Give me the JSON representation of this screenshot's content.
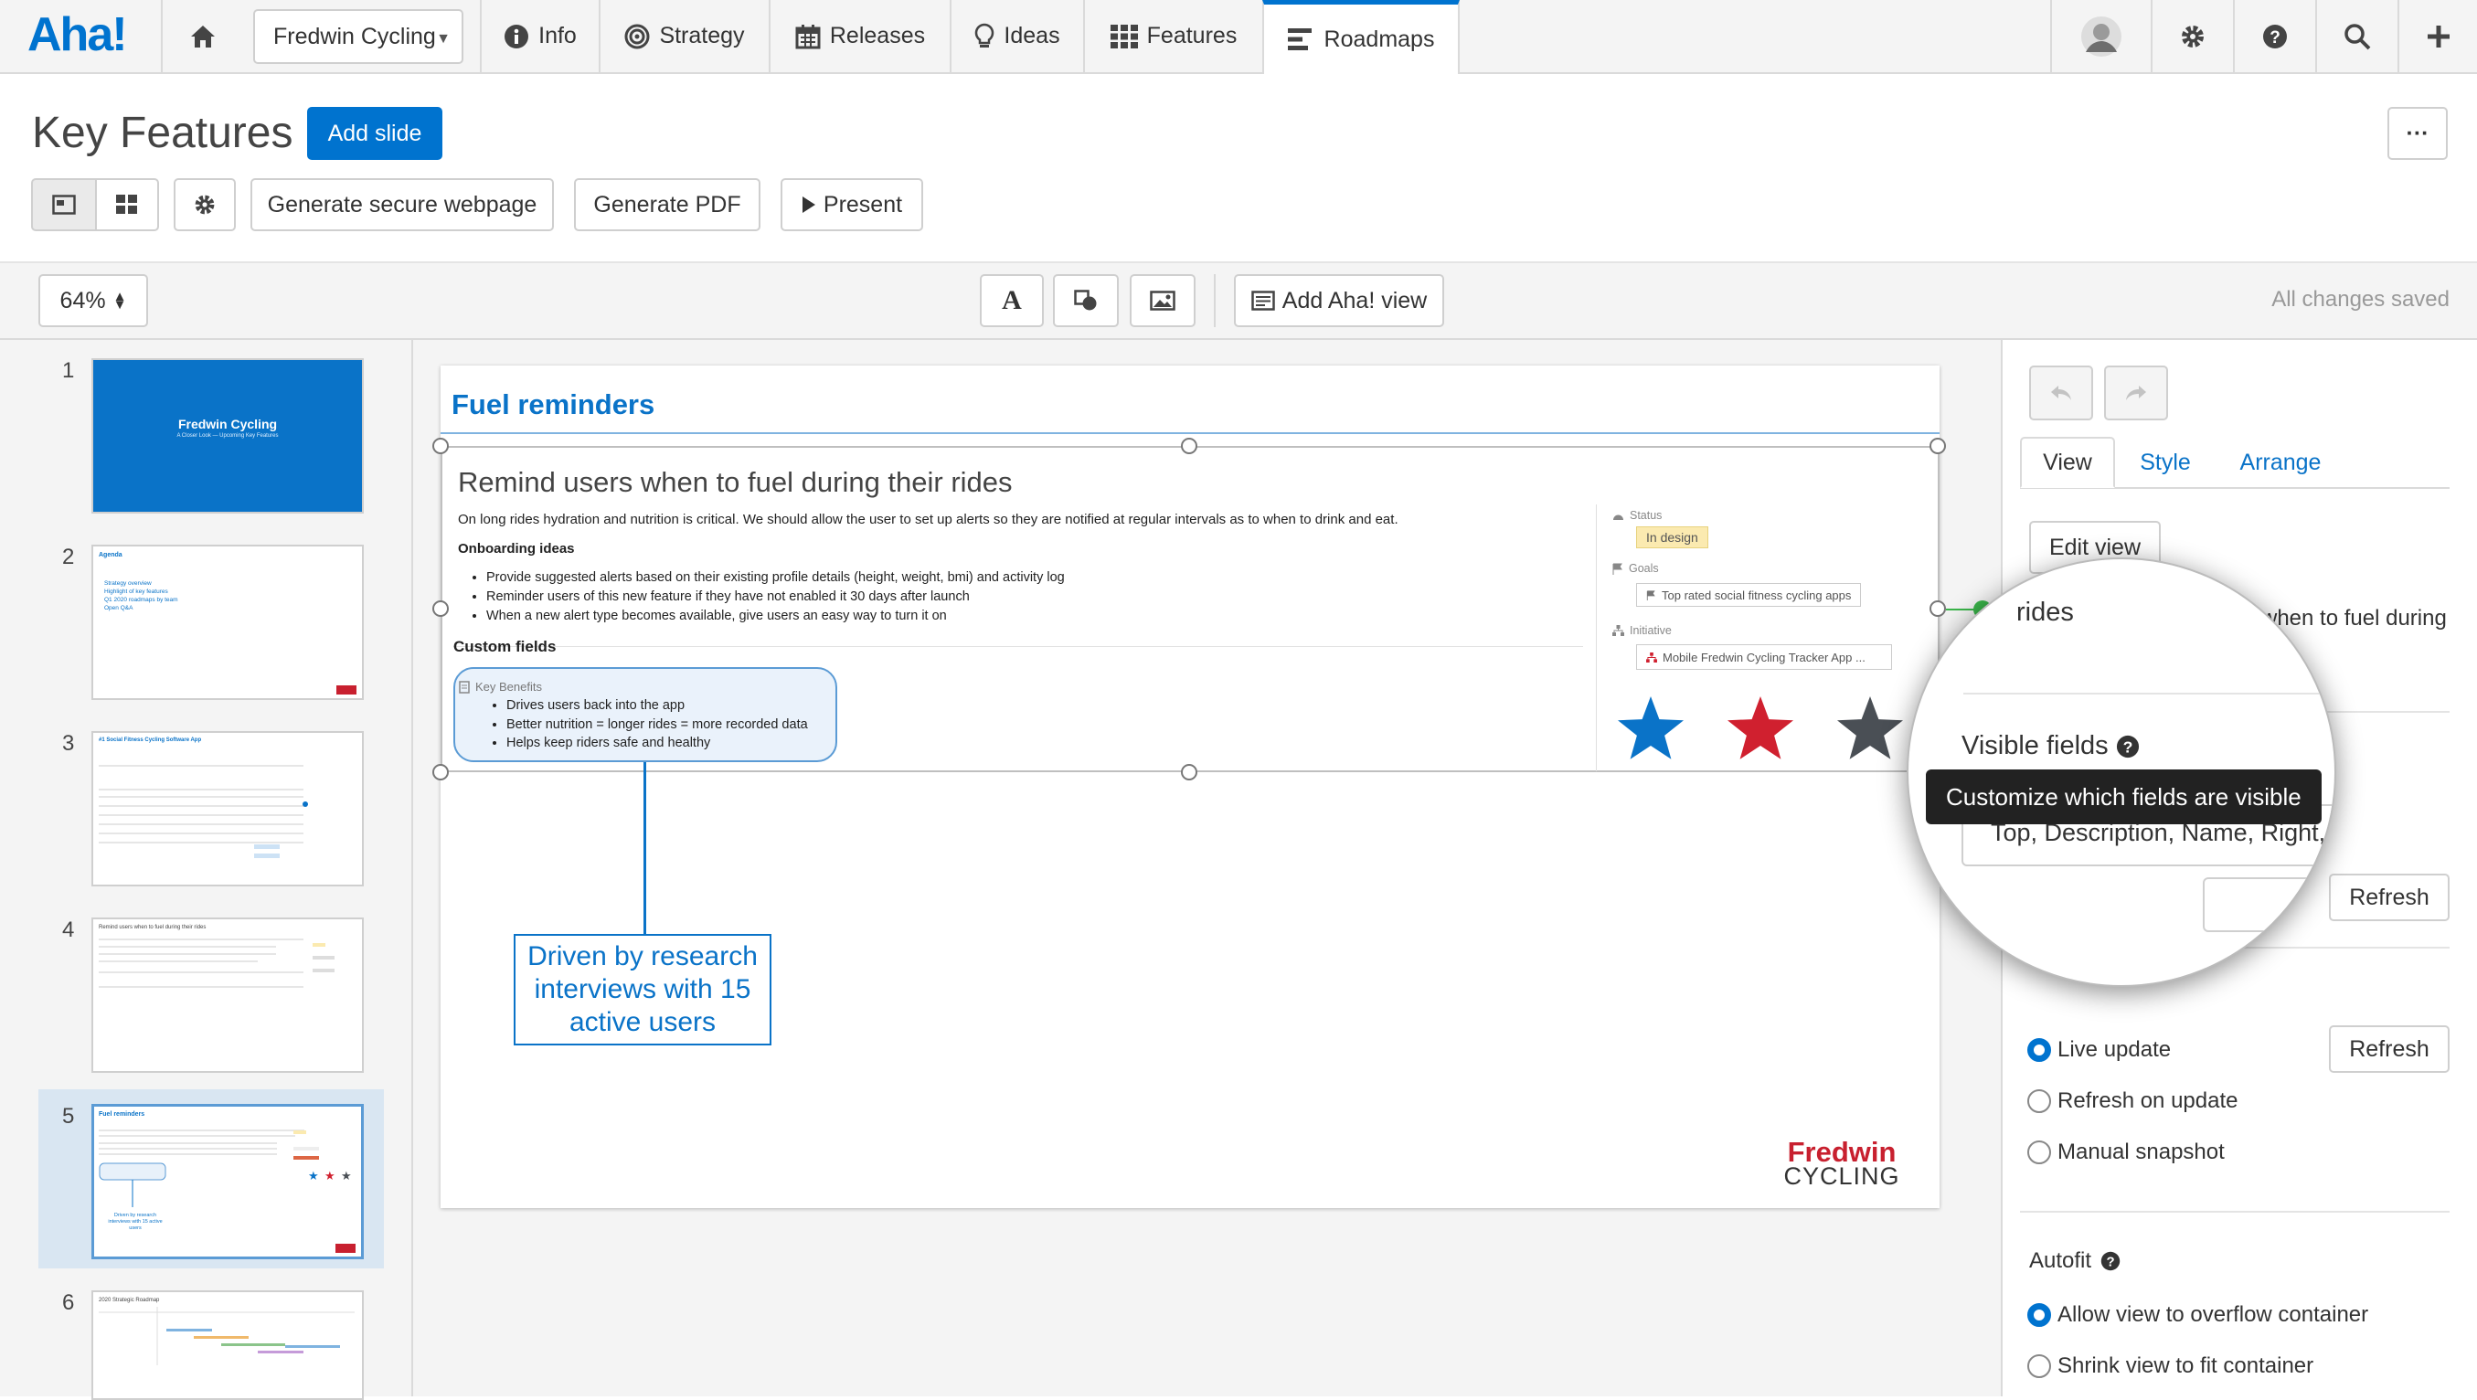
{
  "app": {
    "logo": "Aha!",
    "workspace": "Fredwin Cycling"
  },
  "nav": {
    "tabs": [
      {
        "label": "Info",
        "icon": "info-icon"
      },
      {
        "label": "Strategy",
        "icon": "target-icon"
      },
      {
        "label": "Releases",
        "icon": "calendar-icon"
      },
      {
        "label": "Ideas",
        "icon": "lightbulb-icon"
      },
      {
        "label": "Features",
        "icon": "grid-icon"
      },
      {
        "label": "Roadmaps",
        "icon": "roadmap-icon"
      }
    ],
    "active": "Roadmaps"
  },
  "header": {
    "title": "Key Features",
    "add_slide": "Add slide",
    "more": "···",
    "generate_webpage": "Generate secure webpage",
    "generate_pdf": "Generate PDF",
    "present": "Present"
  },
  "toolbar": {
    "zoom": "64%",
    "add_view": "Add Aha! view",
    "status": "All changes saved"
  },
  "thumbnails": [
    {
      "num": "1",
      "title": "Fredwin Cycling",
      "subtitle": "A Closer Look — Upcoming Key Features"
    },
    {
      "num": "2",
      "title": "Agenda",
      "items": [
        "Strategy overview",
        "Highlight of key features",
        "Q1 2020 roadmaps by team",
        "Open Q&A"
      ]
    },
    {
      "num": "3",
      "title": "#1 Social Fitness Cycling Software App"
    },
    {
      "num": "4",
      "title": "Remind users when to fuel during their rides"
    },
    {
      "num": "5",
      "title": "Fuel reminders",
      "callout": "Driven by research interviews with 15 active users"
    },
    {
      "num": "6",
      "title": "2020 Strategic Roadmap"
    }
  ],
  "slide": {
    "title": "Fuel reminders",
    "feature": {
      "name": "Remind users when to fuel during their rides",
      "description": "On long rides hydration and nutrition is critical. We should allow the user to set up alerts so they are notified at regular intervals as to when to drink and eat.",
      "onboarding_heading": "Onboarding ideas",
      "onboarding": [
        "Provide suggested alerts based on their existing profile details (height, weight, bmi) and activity log",
        "Reminder users of this new feature if they have not enabled it 30 days after launch",
        "When a new alert type becomes available, give users an easy way to turn it on"
      ],
      "custom_fields_heading": "Custom fields",
      "benefits_label": "Key Benefits",
      "benefits": [
        "Drives users back into the app",
        "Better nutrition = longer rides = more recorded data",
        "Helps keep riders safe and healthy"
      ],
      "status_label": "Status",
      "status_value": "In design",
      "goals_label": "Goals",
      "goals_value": "Top rated social fitness cycling apps",
      "initiative_label": "Initiative",
      "initiative_value": "Mobile Fredwin Cycling Tracker App ...",
      "star_colors": [
        "#0a73c8",
        "#d0202f",
        "#4a4f55"
      ]
    },
    "callout": "Driven by research interviews with 15 active users",
    "brand_top": "Fredwin",
    "brand_bottom": "CYCLING"
  },
  "panel": {
    "tabs": [
      "View",
      "Style",
      "Arrange"
    ],
    "edit_view": "Edit view",
    "view_name_partial": "when to fuel during",
    "rides_partial": "rides",
    "visible_fields_label": "Visible fields",
    "tooltip": "Customize which fields are visible",
    "fields_value": "Top, Description, Name, Right, Go...",
    "refresh": "Refresh",
    "update_options": [
      "Live update",
      "Refresh on update",
      "Manual snapshot"
    ],
    "update_selected": "Live update",
    "autofit_label": "Autofit",
    "autofit_options": [
      "Allow view to overflow container",
      "Shrink view to fit container"
    ],
    "autofit_selected": "Allow view to overflow container"
  },
  "colors": {
    "accent": "#0073cf",
    "brand_red": "#c8202f",
    "status_badge": "#fbeab0"
  }
}
